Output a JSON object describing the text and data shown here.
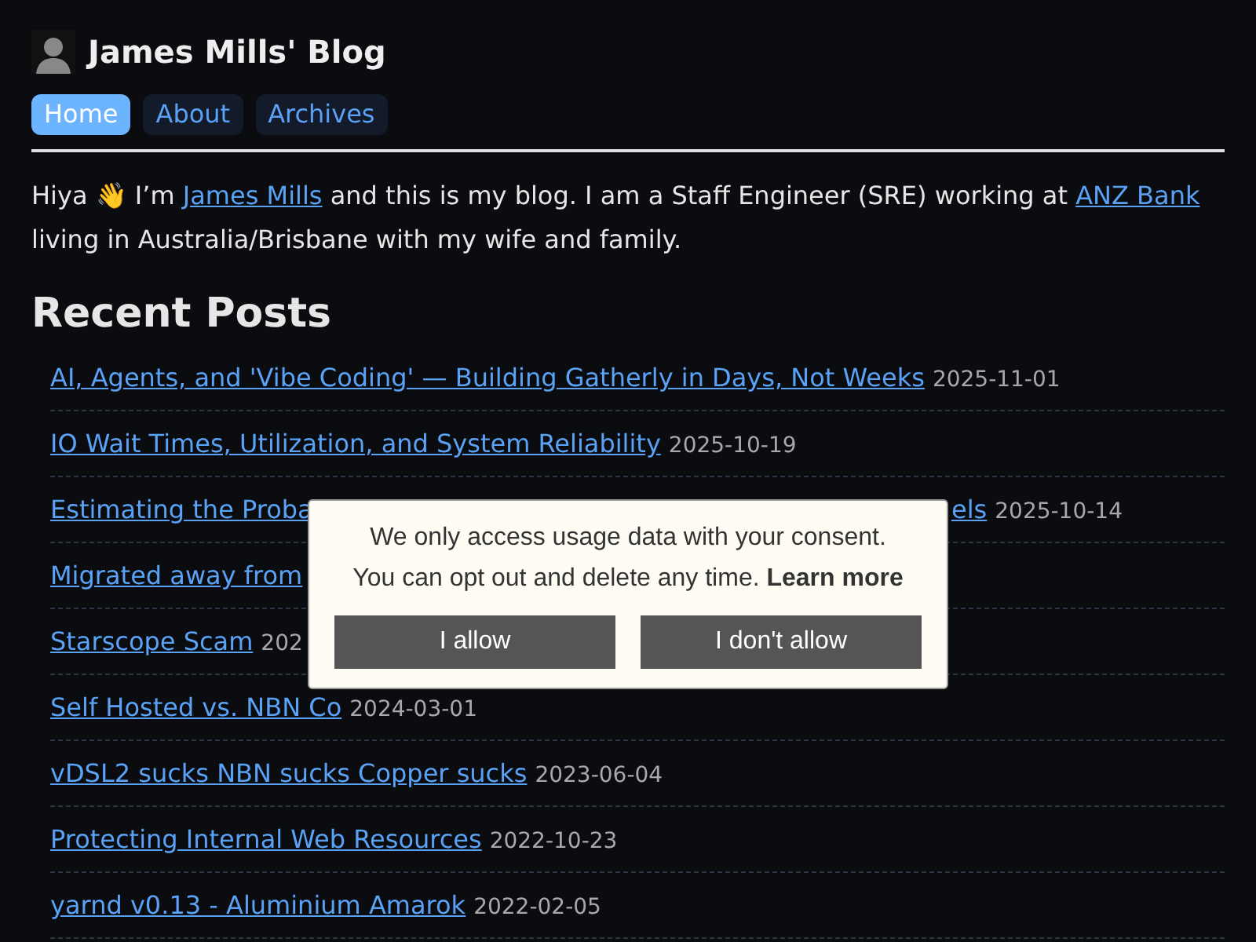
{
  "site": {
    "title": "James Mills' Blog"
  },
  "nav": [
    {
      "label": "Home",
      "selected": true
    },
    {
      "label": "About",
      "selected": false
    },
    {
      "label": "Archives",
      "selected": false
    }
  ],
  "intro": [
    {
      "kind": "text",
      "text": "Hiya 👋 I’m "
    },
    {
      "kind": "link",
      "text": "James Mills"
    },
    {
      "kind": "text",
      "text": " and this is my blog. I am a Staff Engineer (SRE) working at "
    },
    {
      "kind": "link",
      "text": "ANZ Bank"
    },
    {
      "kind": "text",
      "text": " living in Australia/Brisbane with my wife and family."
    }
  ],
  "recent_posts": {
    "heading": "Recent Posts",
    "posts": [
      {
        "title": "AI, Agents, and 'Vibe Coding' — Building Gatherly in Days, Not Weeks",
        "date": "2025-11-01"
      },
      {
        "title": "IO Wait Times, Utilization, and System Reliability",
        "date": "2025-10-19"
      },
      {
        "title": "Estimating the Proba",
        "title_tail": "els",
        "date": "2025-10-14"
      },
      {
        "title": "Migrated away from"
      },
      {
        "title": "Starscope Scam",
        "date": "202"
      },
      {
        "title": "Self Hosted vs. NBN Co",
        "date": "2024-03-01"
      },
      {
        "title": "vDSL2 sucks NBN sucks Copper sucks",
        "date": "2023-06-04"
      },
      {
        "title": "Protecting Internal Web Resources",
        "date": "2022-10-23"
      },
      {
        "title": "yarnd v0.13 - Aluminium Amarok",
        "date": "2022-02-05"
      }
    ]
  },
  "consent": {
    "lines": [
      "We only access usage data with your consent.",
      "You can opt out and delete any time. **Learn more**"
    ],
    "buttons": [
      "I allow",
      "I don't allow"
    ]
  }
}
